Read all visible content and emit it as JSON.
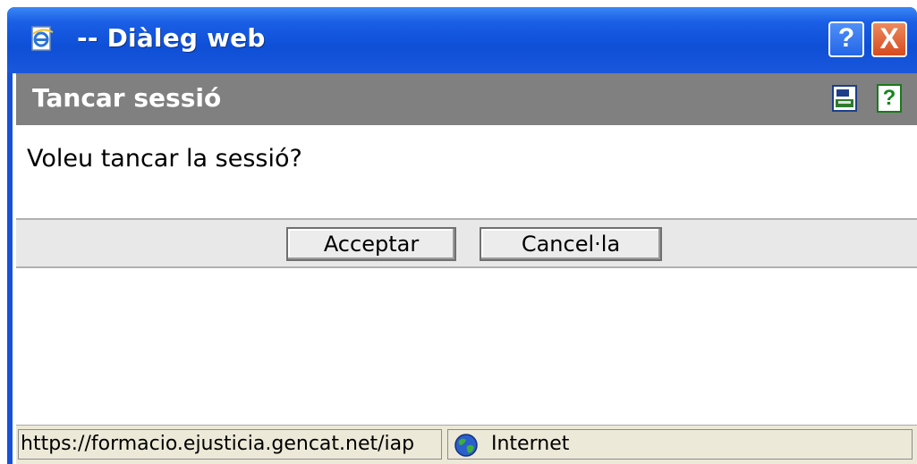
{
  "window": {
    "title": "-- Diàleg web",
    "help_button": "?",
    "close_button": "X",
    "icon": "ie-document-icon"
  },
  "dialog": {
    "header_title": "Tancar sessió",
    "header_icons": [
      "print-icon",
      "help-icon"
    ],
    "help_icon_glyph": "?",
    "message": "Voleu tancar la sessió?",
    "buttons": {
      "accept_label": "Acceptar",
      "cancel_label": "Cancel·la"
    }
  },
  "statusbar": {
    "url": "https://formacio.ejusticia.gencat.net/iap",
    "zone": "Internet",
    "zone_icon": "globe-icon"
  },
  "colors": {
    "titlebar": "#0e4fd6",
    "header_bar": "#808080",
    "button_bar": "#e8e8e8",
    "statusbar": "#ece9d8",
    "close_button": "#d64b1f",
    "help_icon": "#18861c"
  }
}
